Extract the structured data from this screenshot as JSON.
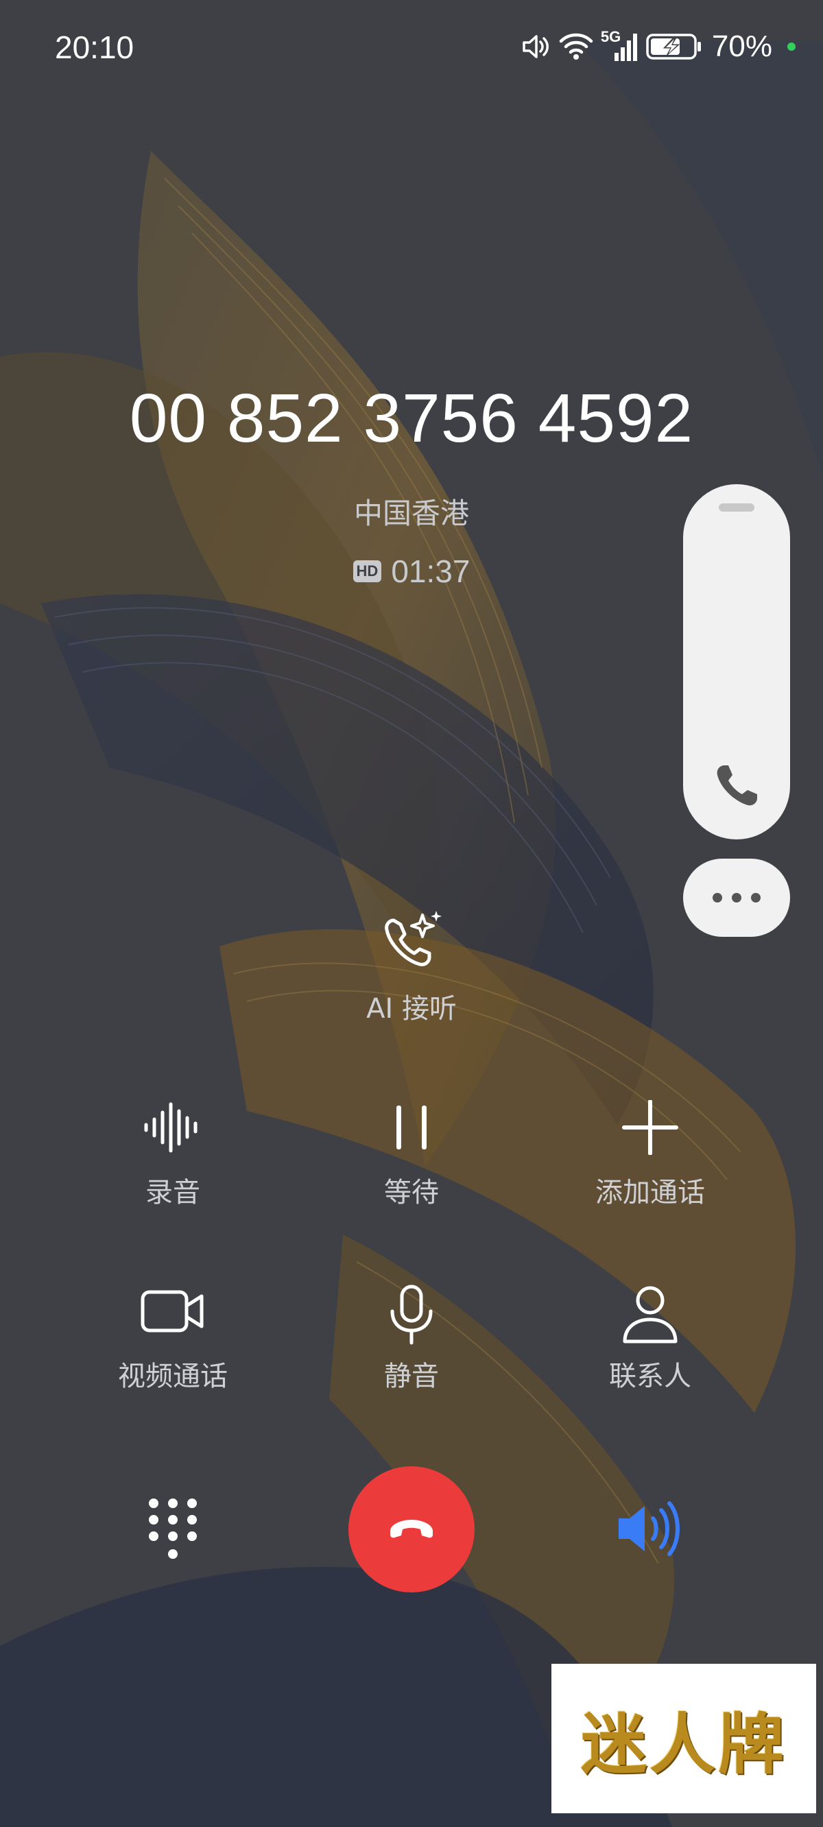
{
  "status_bar": {
    "time": "20:10",
    "network": "5G",
    "battery": "70%",
    "icons": [
      "volume-icon",
      "wifi-icon",
      "signal-icon",
      "battery-charging-icon"
    ],
    "dot_color": "#2fd15b"
  },
  "caller": {
    "number": "00 852 3756 4592",
    "location": "中国香港",
    "hd_badge": "HD",
    "duration": "01:37"
  },
  "side_panel": {
    "icons": [
      "phone-icon",
      "more-icon"
    ]
  },
  "ai_answer": {
    "label": "AI 接听",
    "icon": "ai-phone-sparkle-icon"
  },
  "controls": [
    {
      "label": "录音",
      "icon": "waveform-icon"
    },
    {
      "label": "等待",
      "icon": "pause-icon"
    },
    {
      "label": "添加通话",
      "icon": "plus-icon"
    },
    {
      "label": "视频通话",
      "icon": "video-camera-icon"
    },
    {
      "label": "静音",
      "icon": "microphone-icon"
    },
    {
      "label": "联系人",
      "icon": "person-icon"
    }
  ],
  "bottom_bar": {
    "keypad_icon": "dialpad-icon",
    "end_call_icon": "hang-up-icon",
    "speaker_icon": "speaker-icon",
    "end_call_color": "#ec3b3b",
    "speaker_color": "#3a7bf6"
  },
  "watermark": {
    "text": "迷人牌"
  }
}
